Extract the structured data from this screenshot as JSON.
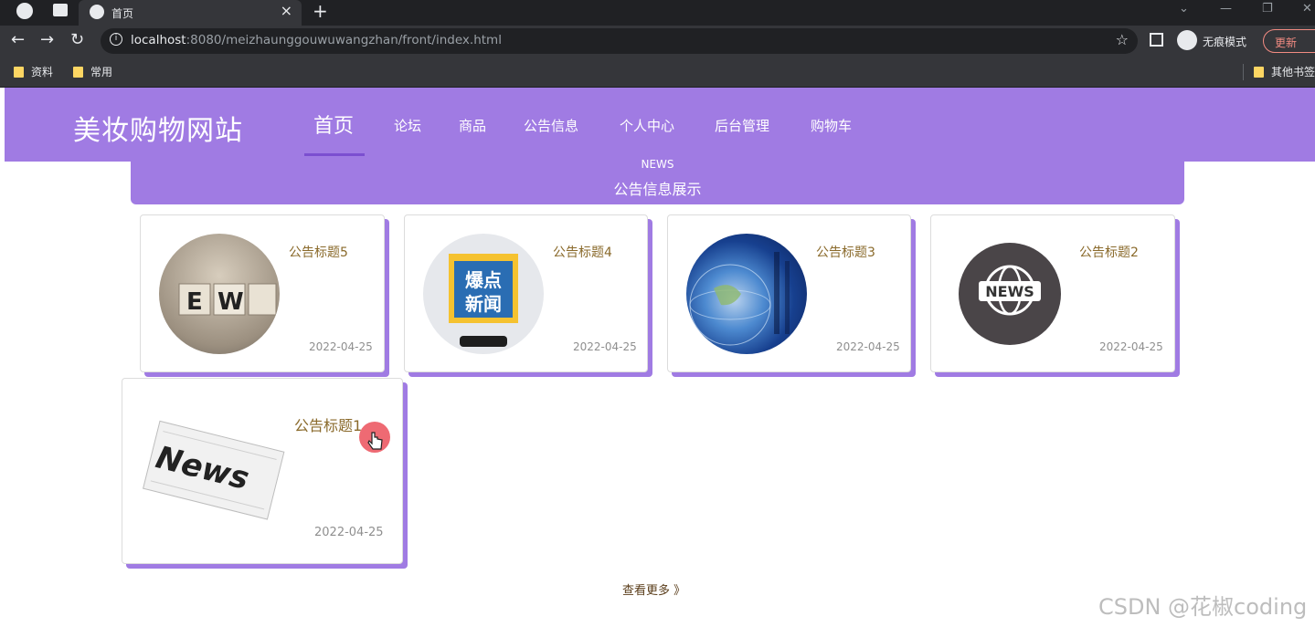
{
  "browser": {
    "tab_title": "首页",
    "url_host": "localhost",
    "url_rest": ":8080/meizhaunggouwuwangzhan/front/index.html",
    "incognito_label": "无痕模式",
    "update_label": "更新",
    "bookmarks": [
      "资料",
      "常用"
    ],
    "other_bookmarks": "其他书签"
  },
  "site": {
    "title": "美妆购物网站",
    "nav": [
      "首页",
      "论坛",
      "商品",
      "公告信息",
      "个人中心",
      "后台管理",
      "购物车"
    ]
  },
  "notice": {
    "heading_en": "NEWS",
    "heading_cn": "公告信息展示",
    "items": [
      {
        "title": "公告标题5",
        "date": "2022-04-25",
        "image": "news-blocks"
      },
      {
        "title": "公告标题4",
        "date": "2022-04-25",
        "image": "hot-news"
      },
      {
        "title": "公告标题3",
        "date": "2022-04-25",
        "image": "globe"
      },
      {
        "title": "公告标题2",
        "date": "2022-04-25",
        "image": "news-globe-icon"
      },
      {
        "title": "公告标题1",
        "date": "2022-04-25",
        "image": "newspaper"
      }
    ],
    "more_label": "查看更多 》"
  },
  "watermark": "CSDN @花椒coding",
  "colors": {
    "accent": "#a07be3",
    "accent_dark": "#7b4fd0",
    "title_text": "#8a6a2b"
  }
}
